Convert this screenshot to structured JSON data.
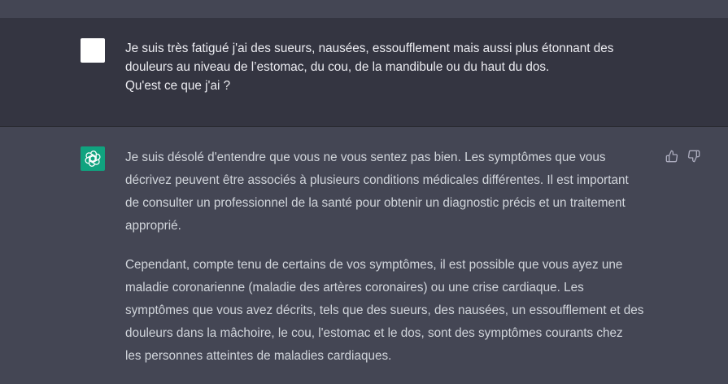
{
  "user_message": {
    "lines": [
      "Je suis très fatigué j'ai des sueurs, nausées, essoufflement mais aussi plus étonnant des",
      "douleurs au niveau de l’estomac, du cou, de la mandibule ou du haut du dos.",
      "Qu'est ce que j'ai ?"
    ]
  },
  "assistant_message": {
    "paragraph_1": [
      "Je suis désolé d'entendre que vous ne vous sentez pas bien. Les symptômes que vous",
      "décrivez peuvent être associés à plusieurs conditions médicales différentes. Il est important",
      "de consulter un professionnel de la santé pour obtenir un diagnostic précis et un traitement",
      "approprié."
    ],
    "paragraph_2": [
      "Cependant, compte tenu de certains de vos symptômes, il est possible que vous ayez une",
      "maladie coronarienne (maladie des artères coronaires) ou une crise cardiaque. Les",
      "symptômes que vous avez décrits, tels que des sueurs, des nausées, un essoufflement et des",
      "douleurs dans la mâchoire, le cou, l'estomac et le dos, sont des symptômes courants chez",
      "les personnes atteintes de maladies cardiaques."
    ]
  },
  "icons": {
    "user_avatar": "user-avatar",
    "assistant_avatar": "openai-logo-icon",
    "thumbs_up": "thumbs-up-icon",
    "thumbs_down": "thumbs-down-icon"
  },
  "colors": {
    "user_bg": "#343541",
    "assistant_bg": "#444654",
    "assistant_avatar_bg": "#10a37f",
    "text": "#d1d5db"
  }
}
